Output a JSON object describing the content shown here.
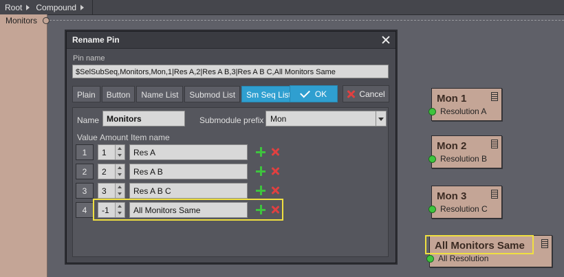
{
  "breadcrumb": {
    "items": [
      "Root",
      "Compound"
    ]
  },
  "canvas": {
    "pin_label": "Monitors"
  },
  "dialog": {
    "title": "Rename Pin",
    "pin_name_label": "Pin name",
    "pin_name_value": "$SelSubSeq,Monitors,Mon,1|Res A,2|Res A B,3|Res A B C,All Monitors Same",
    "tabs": [
      "Plain",
      "Button",
      "Name List",
      "Submod List",
      "Sm Seq List"
    ],
    "active_tab": "Sm Seq List",
    "ok_label": "OK",
    "cancel_label": "Cancel",
    "name_label": "Name",
    "name_value": "Monitors",
    "prefix_label": "Submodule prefix",
    "prefix_value": "Mon",
    "columns": {
      "value": "Value",
      "amount": "Amount",
      "item": "Item name"
    },
    "rows": [
      {
        "value": "1",
        "amount": "1",
        "item": "Res A"
      },
      {
        "value": "2",
        "amount": "2",
        "item": "Res A B"
      },
      {
        "value": "3",
        "amount": "3",
        "item": "Res A B C"
      },
      {
        "value": "4",
        "amount": "-1",
        "item": "All Monitors Same"
      }
    ]
  },
  "nodes": [
    {
      "title": "Mon 1",
      "sub": "Resolution A"
    },
    {
      "title": "Mon 2",
      "sub": "Resolution B"
    },
    {
      "title": "Mon 3",
      "sub": "Resolution C"
    },
    {
      "title": "All Monitors Same",
      "sub": "All Resolution"
    }
  ],
  "colors": {
    "accent": "#2f9fd0",
    "highlight": "#f0e040",
    "node": "#c4a596",
    "add": "#3ec43e",
    "remove": "#e04040"
  }
}
